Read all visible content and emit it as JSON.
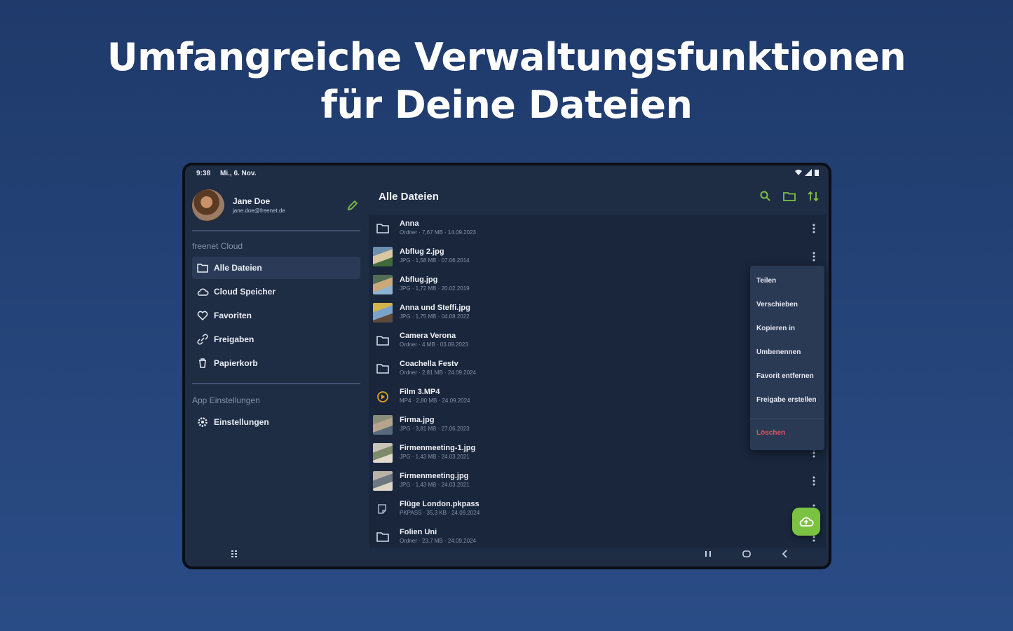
{
  "headline": {
    "line1": "Umfangreiche Verwaltungsfunktionen",
    "line2": "für Deine Dateien"
  },
  "status_bar": {
    "time": "9:38",
    "date": "Mi., 6. Nov."
  },
  "profile": {
    "name": "Jane Doe",
    "email": "jane.doe@freenet.de"
  },
  "sidebar": {
    "section1_label": "freenet Cloud",
    "items": [
      {
        "label": "Alle Dateien",
        "icon": "folder-icon",
        "active": true
      },
      {
        "label": "Cloud Speicher",
        "icon": "cloud-icon",
        "active": false
      },
      {
        "label": "Favoriten",
        "icon": "heart-icon",
        "active": false
      },
      {
        "label": "Freigaben",
        "icon": "link-icon",
        "active": false
      },
      {
        "label": "Papierkorb",
        "icon": "trash-icon",
        "active": false
      }
    ],
    "section2_label": "App Einstellungen",
    "settings_item": {
      "label": "Einstellungen",
      "icon": "gear-icon"
    }
  },
  "appbar": {
    "title": "Alle Dateien",
    "actions": [
      "search-icon",
      "new-folder-icon",
      "sort-icon"
    ],
    "accent": "#7cc242"
  },
  "files": [
    {
      "name": "Anna",
      "meta": "Ordner · 7,67 MB · 14.09.2023",
      "type": "folder"
    },
    {
      "name": "Abflug 2.jpg",
      "meta": "JPG · 1,58 MB · 07.06.2014",
      "type": "photo"
    },
    {
      "name": "Abflug.jpg",
      "meta": "JPG · 1,72 MB · 20.02.2019",
      "type": "photo"
    },
    {
      "name": "Anna und Steffi.jpg",
      "meta": "JPG · 1,75 MB · 04.08.2022",
      "type": "photo"
    },
    {
      "name": "Camera Verona",
      "meta": "Ordner · 4 MB · 03.09.2023",
      "type": "folder"
    },
    {
      "name": "Coachella Festv",
      "meta": "Ordner · 2,81 MB · 24.09.2024",
      "type": "folder"
    },
    {
      "name": "Film 3.MP4",
      "meta": "MP4 · 2,80 MB · 24.09.2024",
      "type": "video"
    },
    {
      "name": "Firma.jpg",
      "meta": "JPG · 3,81 MB · 27.06.2023",
      "type": "photo"
    },
    {
      "name": "Firmenmeeting-1.jpg",
      "meta": "JPG · 1,43 MB · 24.03.2021",
      "type": "photo"
    },
    {
      "name": "Firmenmeeting.jpg",
      "meta": "JPG · 1,43 MB · 24.03.2021",
      "type": "photo"
    },
    {
      "name": "Flüge London.pkpass",
      "meta": "PKPASS · 35,3 KB · 24.09.2024",
      "type": "file"
    },
    {
      "name": "Folien Uni",
      "meta": "Ordner · 23,7 MB · 24.09.2024",
      "type": "folder"
    }
  ],
  "context_menu": {
    "items": [
      "Teilen",
      "Verschieben",
      "Kopieren in",
      "Umbenennen",
      "Favorit entfernen",
      "Freigabe erstellen"
    ],
    "danger_item": "Löschen"
  },
  "fab": {
    "icon": "cloud-upload-icon",
    "color": "#7cc242"
  },
  "nav_bar": {
    "icons": [
      "apps-icon",
      "recents-icon",
      "home-icon",
      "back-icon"
    ]
  }
}
